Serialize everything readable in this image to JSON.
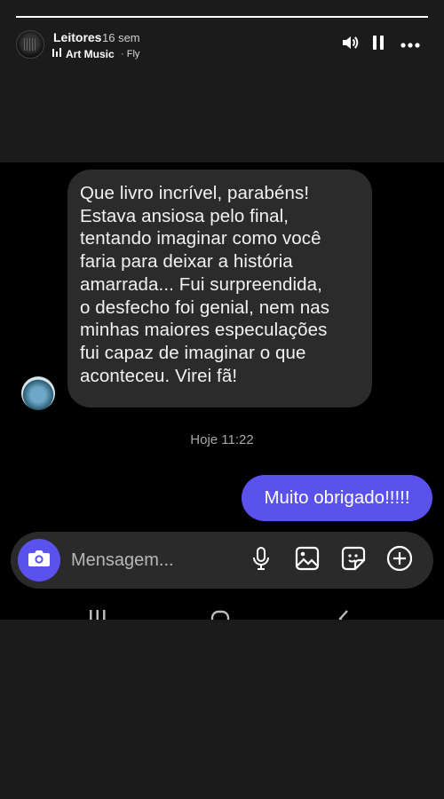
{
  "story": {
    "progress_fraction": 1.0,
    "username": "Leitores",
    "posted_ago": "16 sem",
    "music_title": "Art Music",
    "music_artist": "· Fly",
    "music_icon": "music-bars-icon"
  },
  "header_controls": {
    "volume_icon": "volume-icon",
    "pause_icon": "pause-icon",
    "more_icon": "more-icon"
  },
  "conversation": {
    "received_message_lines": [
      "Que livro incrível, parabéns!",
      "Estava ansiosa pelo final,",
      "tentando imaginar como você",
      "faria para deixar a história",
      "amarrada... Fui surpreendida,",
      "o desfecho foi genial, nem nas",
      "minhas maiores especulações",
      "fui capaz de imaginar o que",
      "aconteceu. Virei fã!"
    ],
    "timestamp": "Hoje 11:22",
    "sent_message": "Muito obrigado!!!!!"
  },
  "composer": {
    "placeholder": "Mensagem...",
    "icons": [
      "camera-icon",
      "mic-icon",
      "gallery-icon",
      "sticker-icon",
      "plus-circle-icon"
    ]
  },
  "colors": {
    "accent": "#5b52ee",
    "received_bubble": "#2b2b2b",
    "chat_background": "#000000",
    "story_background": "#1b1b1b"
  }
}
